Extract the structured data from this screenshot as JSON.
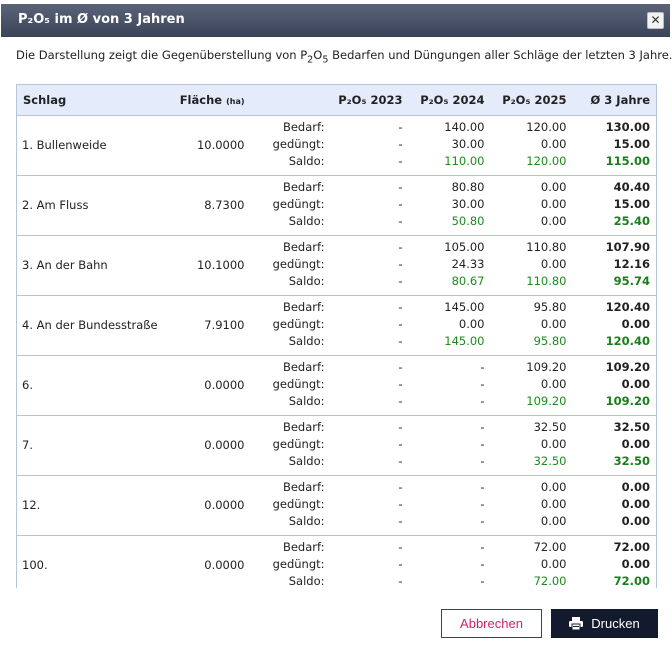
{
  "dialog": {
    "title": "P₂O₅ im Ø von 3 Jahren",
    "close_glyph": "✕",
    "description_pre": "Die Darstellung zeigt die Gegenüberstellung von P",
    "description_sub1": "2",
    "description_mid": "O",
    "description_sub2": "5",
    "description_post": " Bedarfen und Düngungen aller Schläge der letzten 3 Jahre."
  },
  "table": {
    "headers": {
      "schlag": "Schlag",
      "flaeche": "Fläche",
      "flaeche_unit": "(ha)",
      "p2023": "P₂O₅ 2023",
      "p2024": "P₂O₅ 2024",
      "p2025": "P₂O₅ 2025",
      "avg": "Ø 3 Jahre"
    },
    "row_labels": [
      "Bedarf:",
      "gedüngt:",
      "Saldo:"
    ],
    "rows": [
      {
        "name": "1. Bullenweide",
        "area": "10.0000",
        "y2023": [
          "-",
          "-",
          "-"
        ],
        "y2024": [
          "140.00",
          "30.00",
          "110.00"
        ],
        "y2025": [
          "120.00",
          "0.00",
          "120.00"
        ],
        "avg": [
          "130.00",
          "15.00",
          "115.00"
        ]
      },
      {
        "name": "2. Am Fluss",
        "area": "8.7300",
        "y2023": [
          "-",
          "-",
          "-"
        ],
        "y2024": [
          "80.80",
          "30.00",
          "50.80"
        ],
        "y2025": [
          "0.00",
          "0.00",
          "0.00"
        ],
        "avg": [
          "40.40",
          "15.00",
          "25.40"
        ]
      },
      {
        "name": "3. An der Bahn",
        "area": "10.1000",
        "y2023": [
          "-",
          "-",
          "-"
        ],
        "y2024": [
          "105.00",
          "24.33",
          "80.67"
        ],
        "y2025": [
          "110.80",
          "0.00",
          "110.80"
        ],
        "avg": [
          "107.90",
          "12.16",
          "95.74"
        ]
      },
      {
        "name": "4. An der Bundesstraße",
        "area": "7.9100",
        "y2023": [
          "-",
          "-",
          "-"
        ],
        "y2024": [
          "145.00",
          "0.00",
          "145.00"
        ],
        "y2025": [
          "95.80",
          "0.00",
          "95.80"
        ],
        "avg": [
          "120.40",
          "0.00",
          "120.40"
        ]
      },
      {
        "name": "6.",
        "area": "0.0000",
        "y2023": [
          "-",
          "-",
          "-"
        ],
        "y2024": [
          "-",
          "-",
          "-"
        ],
        "y2025": [
          "109.20",
          "0.00",
          "109.20"
        ],
        "avg": [
          "109.20",
          "0.00",
          "109.20"
        ]
      },
      {
        "name": "7.",
        "area": "0.0000",
        "y2023": [
          "-",
          "-",
          "-"
        ],
        "y2024": [
          "-",
          "-",
          "-"
        ],
        "y2025": [
          "32.50",
          "0.00",
          "32.50"
        ],
        "avg": [
          "32.50",
          "0.00",
          "32.50"
        ]
      },
      {
        "name": "12.",
        "area": "0.0000",
        "y2023": [
          "-",
          "-",
          "-"
        ],
        "y2024": [
          "-",
          "-",
          "-"
        ],
        "y2025": [
          "0.00",
          "0.00",
          "0.00"
        ],
        "avg": [
          "0.00",
          "0.00",
          "0.00"
        ]
      },
      {
        "name": "100.",
        "area": "0.0000",
        "y2023": [
          "-",
          "-",
          "-"
        ],
        "y2024": [
          "-",
          "-",
          "-"
        ],
        "y2025": [
          "72.00",
          "0.00",
          "72.00"
        ],
        "avg": [
          "72.00",
          "0.00",
          "72.00"
        ]
      }
    ]
  },
  "buttons": {
    "cancel": "Abbrechen",
    "print": "Drucken",
    "print_icon": "printer-icon"
  },
  "colors": {
    "titlebar": "#3b4357",
    "header_bg": "#e4ebfa",
    "positive_saldo": "#1e8a1e",
    "cancel_text": "#d0226a",
    "print_bg": "#141a2e"
  }
}
